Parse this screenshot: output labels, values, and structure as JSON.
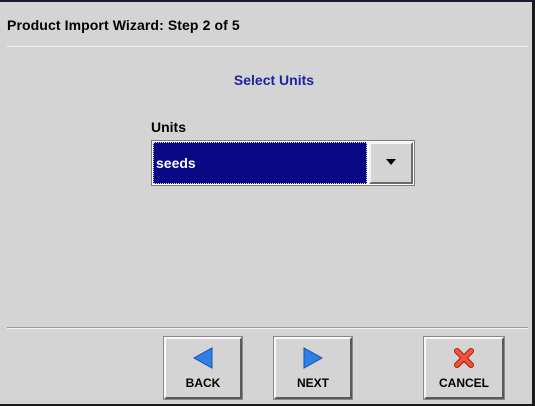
{
  "window": {
    "title": "Product Import Wizard:  Step 2 of 5"
  },
  "main": {
    "heading": "Select Units",
    "units_label": "Units",
    "units_selected": "seeds"
  },
  "buttons": {
    "back": {
      "label": "BACK",
      "icon": "left-arrow-icon"
    },
    "next": {
      "label": "NEXT",
      "icon": "right-arrow-icon"
    },
    "cancel": {
      "label": "CANCEL",
      "icon": "red-x-icon"
    }
  },
  "colors": {
    "background": "#d4d4d4",
    "heading": "#1f1f9f",
    "selection": "#0a0a86",
    "arrow_icon": "#2f7fe8",
    "cancel_icon": "#e8402a"
  }
}
